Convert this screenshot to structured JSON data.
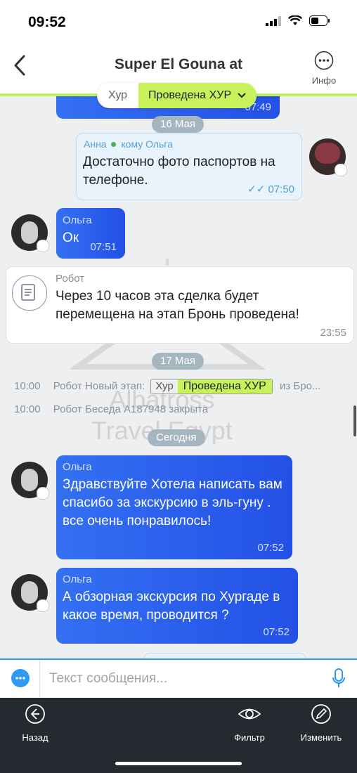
{
  "status": {
    "time": "09:52"
  },
  "header": {
    "title": "Super El Gouna at",
    "info_label": "Инфо"
  },
  "stage": {
    "pipeline": "Хур",
    "current": "Проведена ХУР"
  },
  "messages": {
    "top_cut_time": "07:49",
    "date1": "16 Мая",
    "anna": {
      "author": "Анна",
      "to": "кому Ольга",
      "text": "Достаточно фото паспортов на телефоне.",
      "time": "07:50"
    },
    "olga_ok": {
      "author": "Ольга",
      "text": "Ок",
      "time": "07:51"
    },
    "robot": {
      "author": "Робот",
      "text": "Через 10 часов эта сделка будет перемещена на этап Бронь проведена!",
      "time": "23:55"
    },
    "date2": "17 Мая",
    "sys1": {
      "time": "10:00",
      "prefix": "Робот Новый этап:",
      "from_pipeline": "Хур",
      "from_stage": "Проведена ХУР",
      "suffix": "из Бро..."
    },
    "sys2": {
      "time": "10:00",
      "text": "Робот Беседа А187948 закрыта"
    },
    "date3": "Сегодня",
    "olga_1": {
      "author": "Ольга",
      "text": "Здравствуйте Хотела написать вам спасибо за экскурсию в эль-гуну . все очень понравилось!",
      "time": "07:52"
    },
    "olga_2": {
      "author": "Ольга",
      "text": "А обзорная экскурсия по Хургаде в какое время, проводится ?",
      "time": "07:52"
    }
  },
  "watermark": {
    "line1": "Albatross",
    "line2": "Travel Egypt"
  },
  "composer": {
    "placeholder": "Текст сообщения..."
  },
  "toolbar": {
    "back_label": "Назад",
    "filter_label": "Фильтр",
    "edit_label": "Изменить"
  },
  "colors": {
    "accent": "#2f9af5",
    "bubble": "#2f5ff0",
    "stage_green": "#c8f25a"
  }
}
